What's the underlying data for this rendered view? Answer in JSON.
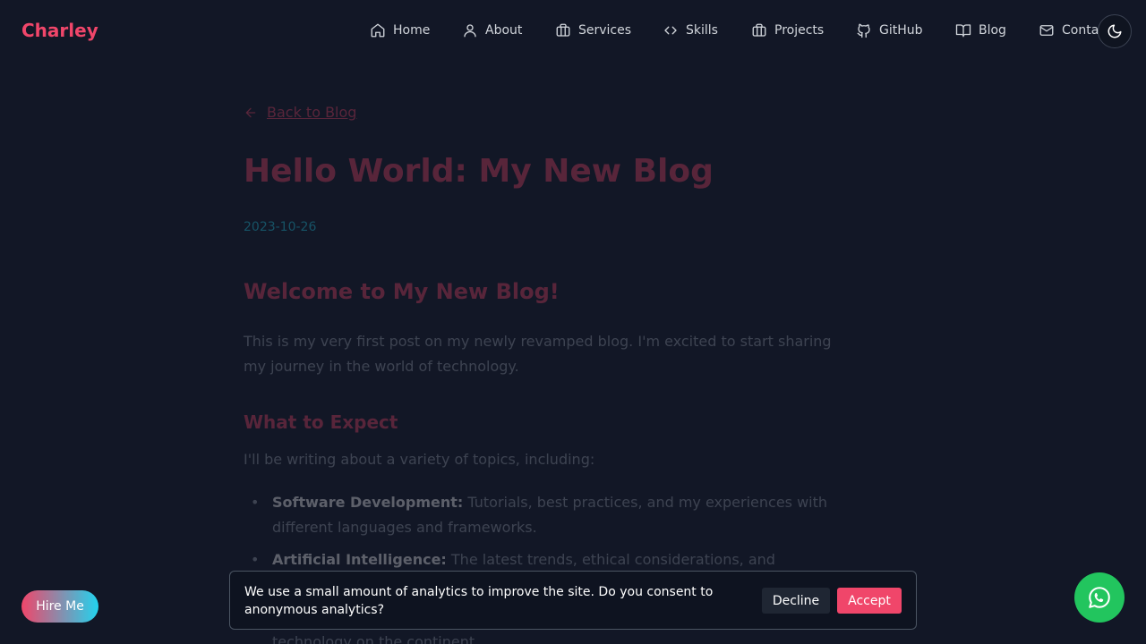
{
  "header": {
    "brand": "Charley",
    "nav": [
      {
        "label": "Home",
        "icon": "home-icon"
      },
      {
        "label": "About",
        "icon": "user-icon"
      },
      {
        "label": "Services",
        "icon": "briefcase-icon"
      },
      {
        "label": "Skills",
        "icon": "code-icon"
      },
      {
        "label": "Projects",
        "icon": "briefcase-icon"
      },
      {
        "label": "GitHub",
        "icon": "github-icon"
      },
      {
        "label": "Blog",
        "icon": "book-open-icon"
      },
      {
        "label": "Contact",
        "icon": "mail-icon"
      }
    ],
    "theme_toggle_icon": "moon-icon"
  },
  "article": {
    "back_label": "Back to Blog",
    "title": "Hello World: My New Blog",
    "date": "2023-10-26",
    "heading": "Welcome to My New Blog!",
    "intro": "This is my very first post on my newly revamped blog. I'm excited to start sharing my journey in the world of technology.",
    "subheading": "What to Expect",
    "lead": "I'll be writing about a variety of topics, including:",
    "topics": [
      {
        "title": "Software Development:",
        "text": "Tutorials, best practices, and my experiences with different languages and frameworks."
      },
      {
        "title": "Artificial Intelligence:",
        "text": "The latest trends, ethical considerations, and"
      }
    ],
    "tail": "technology on the continent."
  },
  "hire": {
    "label": "Hire Me"
  },
  "whatsapp": {
    "icon": "whatsapp-icon"
  },
  "consent": {
    "text": "We use a small amount of analytics to improve the site. Do you consent to anonymous analytics?",
    "decline": "Decline",
    "accept": "Accept"
  },
  "colors": {
    "background": "#121726",
    "brand": "#f0466a",
    "accent": "#22d3ee",
    "whatsapp": "#22c55e"
  }
}
